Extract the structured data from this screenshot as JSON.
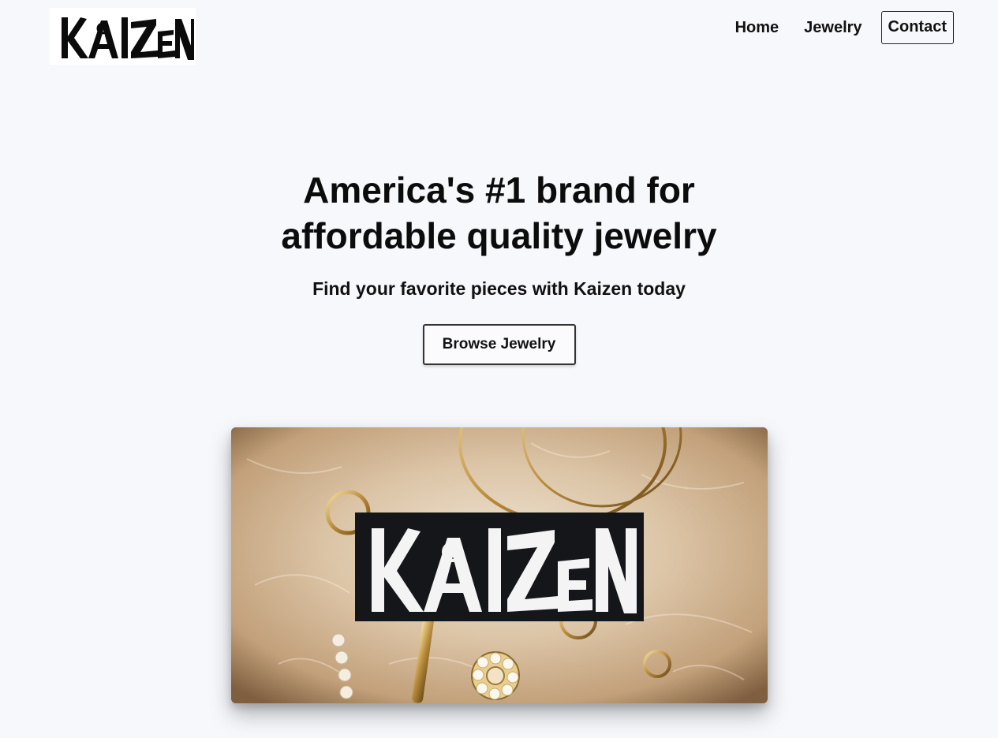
{
  "header": {
    "logo_text": "KAIZEN",
    "nav": {
      "home": "Home",
      "jewelry": "Jewelry",
      "contact": "Contact"
    }
  },
  "hero": {
    "title": "America's #1 brand for affordable quality jewelry",
    "subtitle": "Find your favorite pieces with Kaizen today",
    "cta_label": "Browse Jewelry"
  },
  "feature_image": {
    "brand_text": "KAIZEN",
    "description_icon": "jewelry-photo"
  },
  "colors": {
    "background": "#f7f8fc",
    "text": "#111111",
    "logo_bg": "#ffffff"
  }
}
